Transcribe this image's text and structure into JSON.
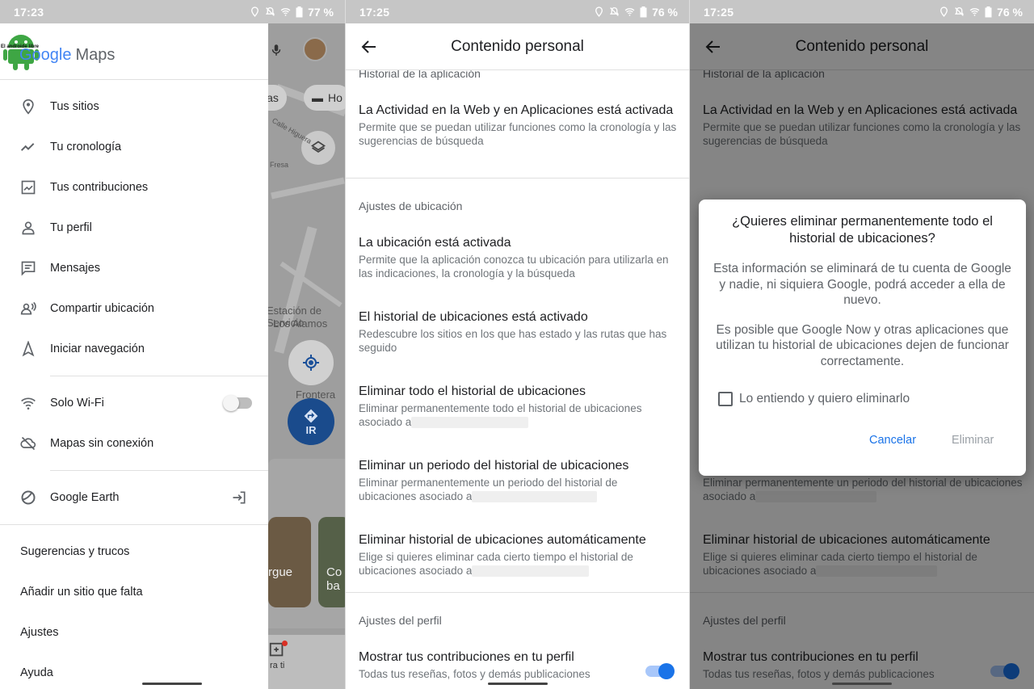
{
  "colors": {
    "accent": "#1a73e8",
    "statusbar": "#c6c6c6",
    "text_secondary": "#5f6368"
  },
  "panel1": {
    "status_time": "17:23",
    "status_battery": "77 %",
    "watermark": "El androide libre",
    "logo_google": "Google",
    "logo_maps": "Maps",
    "map": {
      "chip_1": "cias",
      "chip_2": "Ho",
      "labels": [
        "Calle Higuera",
        "Fresa",
        "Estación de Servicio",
        "Los Alamos",
        "Frontera Pa"
      ],
      "go_label": "IR",
      "card_1": "rgue",
      "card_2": "Co ba",
      "tab_label": "ra ti"
    },
    "menu": [
      {
        "label": "Tus sitios",
        "icon": "pin-icon"
      },
      {
        "label": "Tu cronología",
        "icon": "timeline-icon"
      },
      {
        "label": "Tus contribuciones",
        "icon": "contributions-icon"
      },
      {
        "label": "Tu perfil",
        "icon": "person-icon"
      },
      {
        "label": "Mensajes",
        "icon": "message-icon"
      },
      {
        "label": "Compartir ubicación",
        "icon": "share-location-icon"
      },
      {
        "label": "Iniciar navegación",
        "icon": "navigation-icon"
      }
    ],
    "wifi_only": {
      "label": "Solo Wi-Fi",
      "enabled": false
    },
    "offline_maps": "Mapas sin conexión",
    "google_earth": "Google Earth",
    "extra": [
      "Sugerencias y trucos",
      "Añadir un sitio que falta",
      "Ajustes",
      "Ayuda"
    ]
  },
  "panel2": {
    "status_time": "17:25",
    "status_battery": "76 %",
    "title": "Contenido personal",
    "section_app_history": "Historial de la aplicación",
    "web_activity": {
      "title": "La Actividad en la Web y en Aplicaciones está activada",
      "subtitle": "Permite que se puedan utilizar funciones como la cronología y las sugerencias de búsqueda"
    },
    "section_location": "Ajustes de ubicación",
    "location_on": {
      "title": "La ubicación está activada",
      "subtitle": "Permite que la aplicación conozca tu ubicación para utilizarla en las indicaciones, la cronología y la búsqueda"
    },
    "location_history_on": {
      "title": "El historial de ubicaciones está activado",
      "subtitle": "Redescubre los sitios en los que has estado y las rutas que has seguido"
    },
    "delete_all": {
      "title": "Eliminar todo el historial de ubicaciones",
      "subtitle": "Eliminar permanentemente todo el historial de ubicaciones asociado a"
    },
    "delete_range": {
      "title": "Eliminar un periodo del historial de ubicaciones",
      "subtitle": "Eliminar permanentemente un periodo del historial de ubicaciones asociado a"
    },
    "delete_auto": {
      "title": "Eliminar historial de ubicaciones automáticamente",
      "subtitle": "Elige si quieres eliminar cada cierto tiempo el historial de ubicaciones asociado a"
    },
    "section_profile": "Ajustes del perfil",
    "show_contributions": {
      "title": "Mostrar tus contribuciones en tu perfil",
      "subtitle": "Todas tus reseñas, fotos y demás publicaciones",
      "enabled": true
    }
  },
  "panel3": {
    "status_time": "17:25",
    "status_battery": "76 %",
    "dialog": {
      "title": "¿Quieres eliminar permanentemente todo el historial de ubicaciones?",
      "body_1": "Esta información se eliminará de tu cuenta de Google y nadie, ni siquiera Google, podrá acceder a ella de nuevo.",
      "body_2": "Es posible que Google Now y otras aplicaciones que utilizan tu historial de ubicaciones dejen de funcionar correctamente.",
      "checkbox_label": "Lo entiendo y quiero eliminarlo",
      "checkbox_checked": false,
      "cancel": "Cancelar",
      "delete": "Eliminar"
    }
  }
}
